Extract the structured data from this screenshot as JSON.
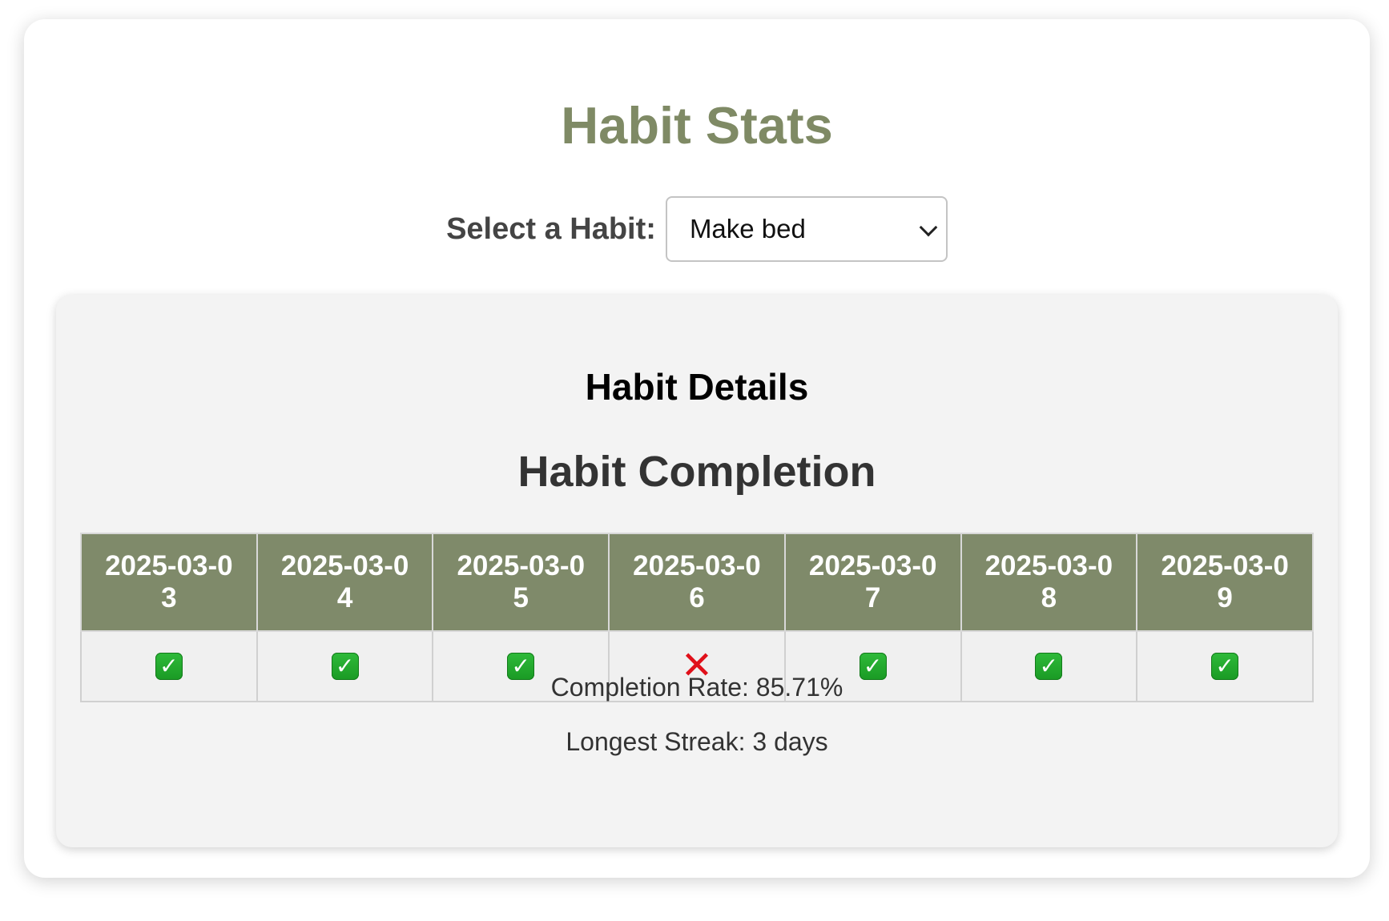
{
  "title": "Habit Stats",
  "selector": {
    "label": "Select a Habit:",
    "selected": "Make bed"
  },
  "details": {
    "heading": "Habit Details",
    "completion_heading": "Habit Completion",
    "table": {
      "dates": [
        "2025-03-03",
        "2025-03-04",
        "2025-03-05",
        "2025-03-06",
        "2025-03-07",
        "2025-03-08",
        "2025-03-09"
      ],
      "status": [
        "done",
        "done",
        "done",
        "missed",
        "done",
        "done",
        "done"
      ],
      "status_icons": {
        "done": "green-check-mark-icon",
        "missed": "red-cross-icon"
      }
    },
    "completion_rate": "Completion Rate: 85.71%",
    "longest_streak": "Longest Streak: 3 days"
  },
  "colors": {
    "accent": "#7f8a65",
    "header_bg": "#7f8a6a",
    "check_green": "#1f9f28",
    "cross_red": "#e0101a"
  }
}
